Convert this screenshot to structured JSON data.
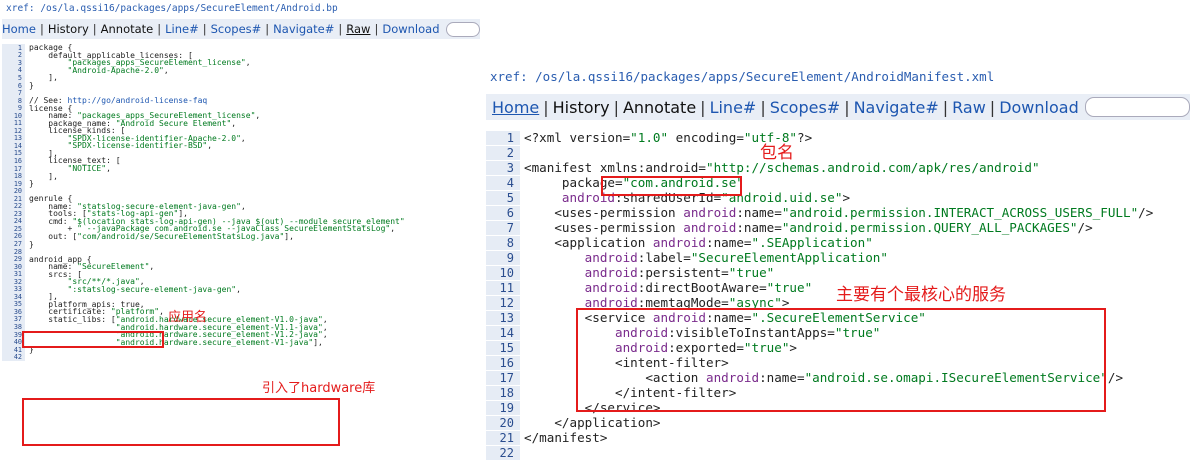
{
  "left": {
    "xref": "xref: /os/la.qssi16/packages/apps/SecureElement/Android.bp",
    "nav": [
      "Home",
      "History",
      "Annotate",
      "Line#",
      "Scopes#",
      "Navigate#",
      "Raw",
      "Download"
    ],
    "lines": [
      {
        "n": "1",
        "t": "package {"
      },
      {
        "n": "2",
        "t": "    default_applicable_licenses: ["
      },
      {
        "n": "3",
        "t": "        \"packages_apps_SecureElement_license\","
      },
      {
        "n": "4",
        "t": "        \"Android-Apache-2.0\","
      },
      {
        "n": "5",
        "t": "    ],"
      },
      {
        "n": "6",
        "t": "}"
      },
      {
        "n": "7",
        "t": ""
      },
      {
        "n": "8",
        "t": "// See: http://go/android-license-faq"
      },
      {
        "n": "9",
        "t": "license {"
      },
      {
        "n": "10",
        "t": "    name: \"packages_apps_SecureElement_license\","
      },
      {
        "n": "11",
        "t": "    package_name: \"Android Secure Element\","
      },
      {
        "n": "12",
        "t": "    license_kinds: ["
      },
      {
        "n": "13",
        "t": "        \"SPDX-license-identifier-Apache-2.0\","
      },
      {
        "n": "14",
        "t": "        \"SPDX-license-identifier-BSD\","
      },
      {
        "n": "15",
        "t": "    ],"
      },
      {
        "n": "16",
        "t": "    license_text: ["
      },
      {
        "n": "17",
        "t": "        \"NOTICE\","
      },
      {
        "n": "18",
        "t": "    ],"
      },
      {
        "n": "19",
        "t": "}"
      },
      {
        "n": "20",
        "t": ""
      },
      {
        "n": "21",
        "t": "genrule {"
      },
      {
        "n": "22",
        "t": "    name: \"statslog-secure-element-java-gen\","
      },
      {
        "n": "23",
        "t": "    tools: [\"stats-log-api-gen\"],"
      },
      {
        "n": "24",
        "t": "    cmd: \"$(location stats-log-api-gen) --java $(out) --module secure_element\""
      },
      {
        "n": "25",
        "t": "        + \" --javaPackage com.android.se --javaClass SecureElementStatsLog\","
      },
      {
        "n": "26",
        "t": "    out: [\"com/android/se/SecureElementStatsLog.java\"],"
      },
      {
        "n": "27",
        "t": "}"
      },
      {
        "n": "28",
        "t": ""
      },
      {
        "n": "29",
        "t": "android_app {"
      },
      {
        "n": "30",
        "t": "    name: \"SecureElement\","
      },
      {
        "n": "31",
        "t": "    srcs: ["
      },
      {
        "n": "32",
        "t": "        \"src/**/*.java\","
      },
      {
        "n": "33",
        "t": "        \":statslog-secure-element-java-gen\","
      },
      {
        "n": "34",
        "t": "    ],"
      },
      {
        "n": "35",
        "t": "    platform_apis: true,"
      },
      {
        "n": "36",
        "t": "    certificate: \"platform\","
      },
      {
        "n": "37",
        "t": "    static_libs: [\"android.hardware.secure_element-V1.0-java\","
      },
      {
        "n": "38",
        "t": "                  \"android.hardware.secure_element-V1.1-java\","
      },
      {
        "n": "39",
        "t": "                  \"android.hardware.secure_element-V1.2-java\","
      },
      {
        "n": "40",
        "t": "                  \"android.hardware.secure_element-V1-java\"],"
      },
      {
        "n": "41",
        "t": "}"
      },
      {
        "n": "42",
        "t": ""
      }
    ],
    "notes": {
      "app_name": "应用名",
      "hardware": "引入了hardware库"
    }
  },
  "right": {
    "xref": "xref: /os/la.qssi16/packages/apps/SecureElement/AndroidManifest.xml",
    "nav": [
      "Home",
      "History",
      "Annotate",
      "Line#",
      "Scopes#",
      "Navigate#",
      "Raw",
      "Download"
    ],
    "lines": [
      {
        "n": "1",
        "t": "<?xml version=\"1.0\" encoding=\"utf-8\"?>"
      },
      {
        "n": "2",
        "t": ""
      },
      {
        "n": "3",
        "t": "<manifest xmlns:android=\"http://schemas.android.com/apk/res/android\""
      },
      {
        "n": "4",
        "t": "     package=\"com.android.se\""
      },
      {
        "n": "5",
        "t": "     android:sharedUserId=\"android.uid.se\">"
      },
      {
        "n": "6",
        "t": "    <uses-permission android:name=\"android.permission.INTERACT_ACROSS_USERS_FULL\"/>"
      },
      {
        "n": "7",
        "t": "    <uses-permission android:name=\"android.permission.QUERY_ALL_PACKAGES\"/>"
      },
      {
        "n": "8",
        "t": "    <application android:name=\".SEApplication\""
      },
      {
        "n": "9",
        "t": "        android:label=\"SecureElementApplication\""
      },
      {
        "n": "10",
        "t": "        android:persistent=\"true\""
      },
      {
        "n": "11",
        "t": "        android:directBootAware=\"true\""
      },
      {
        "n": "12",
        "t": "        android:memtagMode=\"async\">"
      },
      {
        "n": "13",
        "t": "        <service android:name=\".SecureElementService\""
      },
      {
        "n": "14",
        "t": "            android:visibleToInstantApps=\"true\""
      },
      {
        "n": "15",
        "t": "            android:exported=\"true\">"
      },
      {
        "n": "16",
        "t": "            <intent-filter>"
      },
      {
        "n": "17",
        "t": "                <action android:name=\"android.se.omapi.ISecureElementService\"/>"
      },
      {
        "n": "18",
        "t": "            </intent-filter>"
      },
      {
        "n": "19",
        "t": "        </service>"
      },
      {
        "n": "20",
        "t": "    </application>"
      },
      {
        "n": "21",
        "t": "</manifest>"
      },
      {
        "n": "22",
        "t": ""
      }
    ],
    "notes": {
      "package_name": "包名",
      "core_service": "主要有个最核心的服务"
    }
  },
  "colors": {
    "accent_red": "#e41b1b",
    "link_blue": "#1d56b0",
    "string_green": "#007a1f"
  }
}
